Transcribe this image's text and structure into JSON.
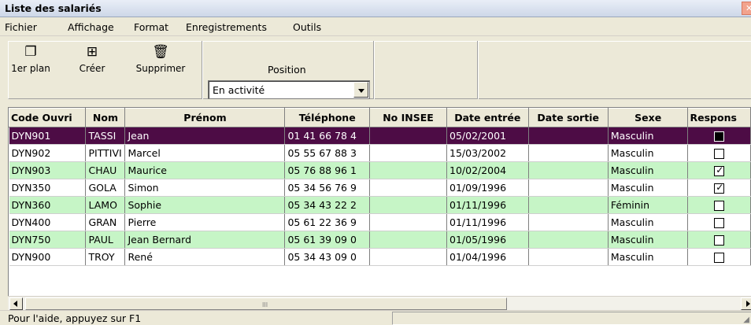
{
  "window": {
    "title": "Liste des salariés"
  },
  "menu": [
    "Fichier",
    "Affichage",
    "Format",
    "Enregistrements",
    "Outils"
  ],
  "toolbar": {
    "buttons": [
      {
        "label": "1er plan",
        "icon": "window-front-icon"
      },
      {
        "label": "Créer",
        "icon": "new-record-icon"
      },
      {
        "label": "Supprimer",
        "icon": "trash-icon"
      }
    ],
    "position": {
      "label": "Position",
      "value": "En activité"
    }
  },
  "table": {
    "columns": [
      "Code Ouvri",
      "Nom",
      "Prénom",
      "Téléphone",
      "No INSEE",
      "Date entrée",
      "Date sortie",
      "Sexe",
      "Respons"
    ],
    "rows": [
      {
        "code": "DYN901",
        "nom": "TASSI",
        "prenom": "Jean",
        "tel": "01 41 66 78 4",
        "insee": "",
        "entree": "05/02/2001",
        "sortie": "",
        "sexe": "Masculin",
        "resp": false,
        "style": "sel"
      },
      {
        "code": "DYN902",
        "nom": "PITTIVI",
        "prenom": "Marcel",
        "tel": "05 55 67 88 3",
        "insee": "",
        "entree": "15/03/2002",
        "sortie": "",
        "sexe": "Masculin",
        "resp": false,
        "style": "white"
      },
      {
        "code": "DYN903",
        "nom": "CHAU",
        "prenom": "Maurice",
        "tel": "05 76 88 96 1",
        "insee": "",
        "entree": "10/02/2004",
        "sortie": "",
        "sexe": "Masculin",
        "resp": true,
        "style": "green"
      },
      {
        "code": "DYN350",
        "nom": "GOLA",
        "prenom": "Simon",
        "tel": "05 34 56 76 9",
        "insee": "",
        "entree": "01/09/1996",
        "sortie": "",
        "sexe": "Masculin",
        "resp": true,
        "style": "white"
      },
      {
        "code": "DYN360",
        "nom": "LAMO",
        "prenom": "Sophie",
        "tel": "05 34 43 22 2",
        "insee": "",
        "entree": "01/11/1996",
        "sortie": "",
        "sexe": "Féminin",
        "resp": false,
        "style": "green"
      },
      {
        "code": "DYN400",
        "nom": "GRAN",
        "prenom": "Pierre",
        "tel": "05 61 22 36 9",
        "insee": "",
        "entree": "01/11/1996",
        "sortie": "",
        "sexe": "Masculin",
        "resp": false,
        "style": "white"
      },
      {
        "code": "DYN750",
        "nom": "PAUL",
        "prenom": "Jean Bernard",
        "tel": "05 61 39 09 0",
        "insee": "",
        "entree": "01/05/1996",
        "sortie": "",
        "sexe": "Masculin",
        "resp": false,
        "style": "green"
      },
      {
        "code": "DYN900",
        "nom": "TROY",
        "prenom": "René",
        "tel": "05 34 43 09 0",
        "insee": "",
        "entree": "01/04/1996",
        "sortie": "",
        "sexe": "Masculin",
        "resp": false,
        "style": "white"
      }
    ]
  },
  "scrollbar": {
    "grip": "III"
  },
  "status": {
    "text": "Pour l'aide, appuyez sur F1"
  },
  "colors": {
    "selected_row": "#4d0c45",
    "alt_row": "#c6f5c6",
    "chrome": "#ece9d8"
  }
}
